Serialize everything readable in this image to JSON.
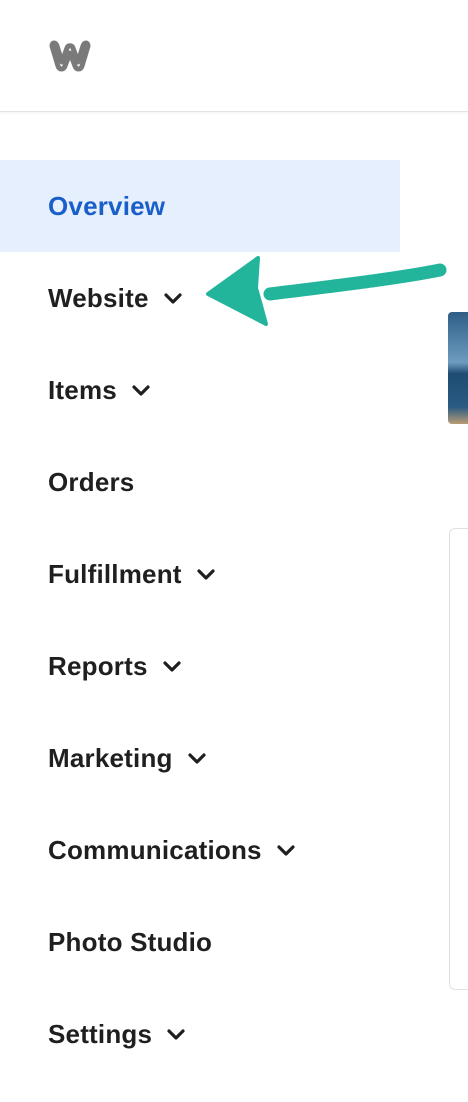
{
  "brand": {
    "logo_icon": "weebly-w-logo"
  },
  "sidebar": {
    "items": [
      {
        "label": "Overview",
        "active": true,
        "has_chevron": false
      },
      {
        "label": "Website",
        "active": false,
        "has_chevron": true
      },
      {
        "label": "Items",
        "active": false,
        "has_chevron": true
      },
      {
        "label": "Orders",
        "active": false,
        "has_chevron": false
      },
      {
        "label": "Fulfillment",
        "active": false,
        "has_chevron": true
      },
      {
        "label": "Reports",
        "active": false,
        "has_chevron": true
      },
      {
        "label": "Marketing",
        "active": false,
        "has_chevron": true
      },
      {
        "label": "Communications",
        "active": false,
        "has_chevron": true
      },
      {
        "label": "Photo Studio",
        "active": false,
        "has_chevron": false
      },
      {
        "label": "Settings",
        "active": false,
        "has_chevron": true
      }
    ]
  },
  "annotation": {
    "arrow_icon": "annotation-arrow-icon",
    "color": "#22b59b"
  },
  "colors": {
    "active_text": "#1a5fc9",
    "active_bg": "#e6effd",
    "text": "#1f1f1f",
    "logo": "#7a7a7a"
  }
}
